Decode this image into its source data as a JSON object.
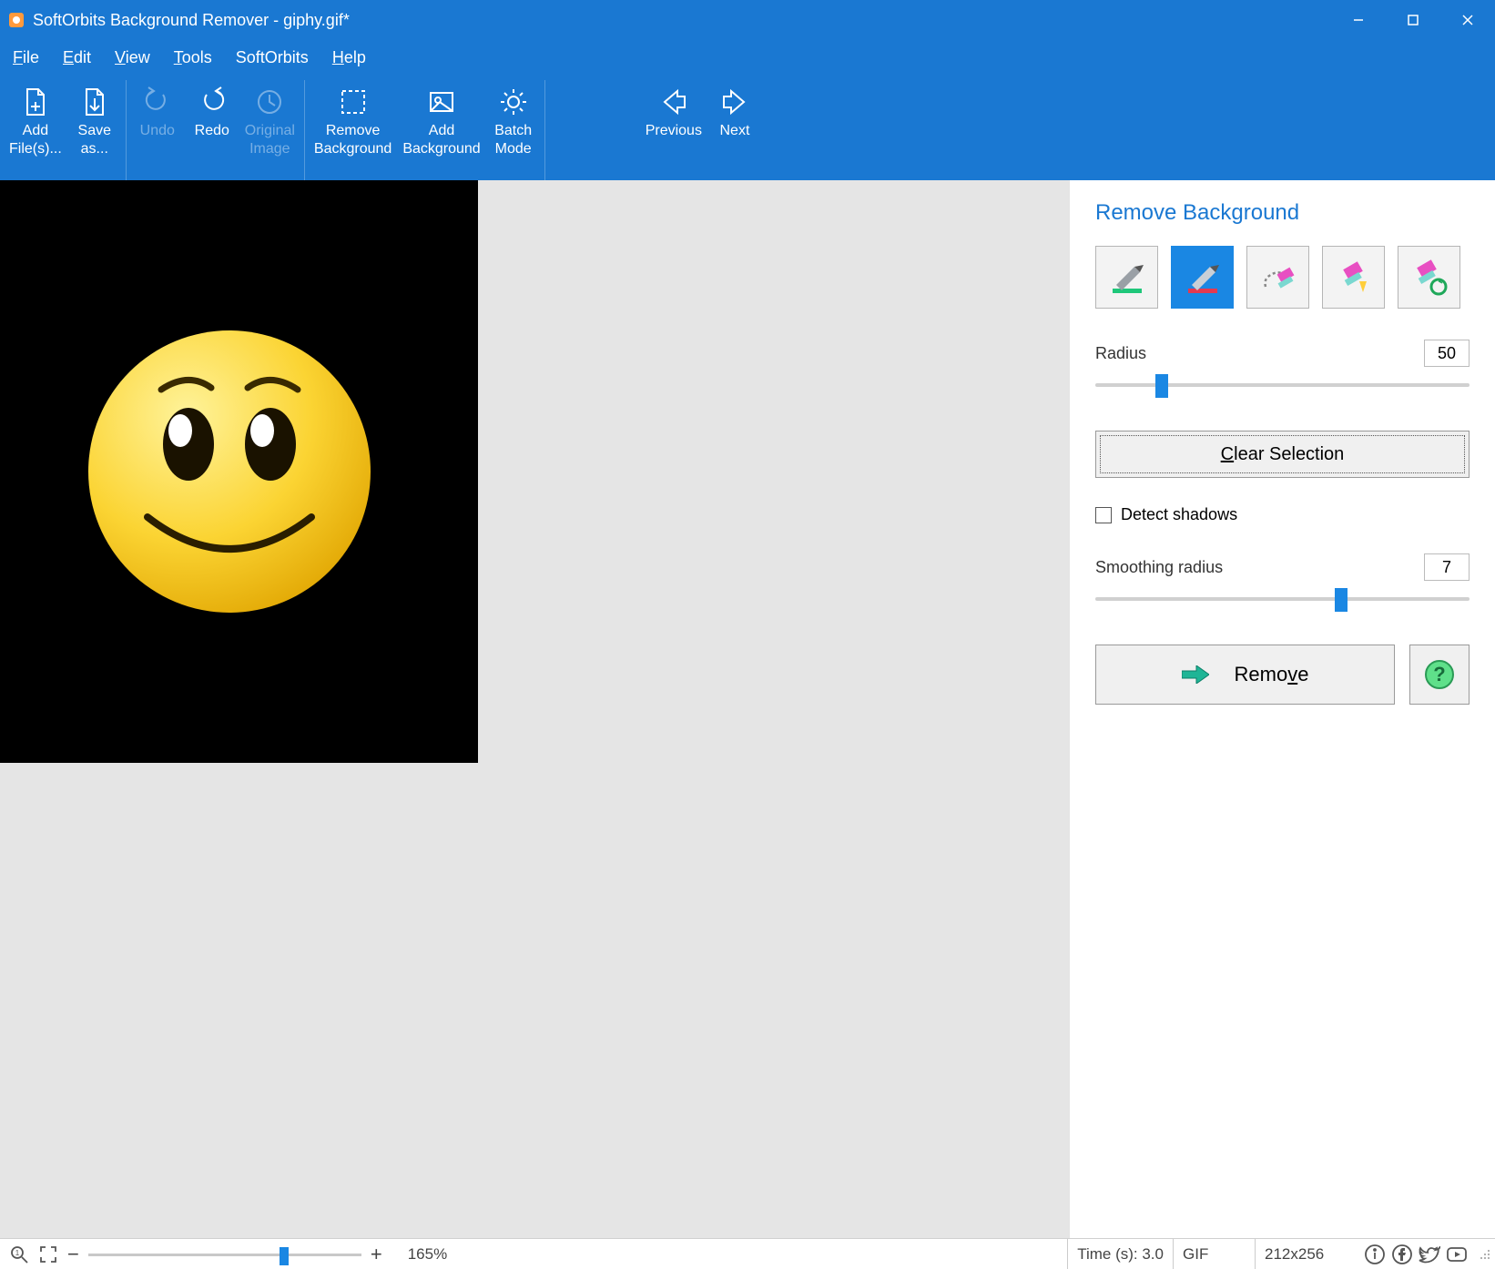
{
  "title": "SoftOrbits Background Remover - giphy.gif*",
  "menu": {
    "file": "File",
    "edit": "Edit",
    "view": "View",
    "tools": "Tools",
    "softorbits": "SoftOrbits",
    "help": "Help"
  },
  "toolbar": {
    "add_files": "Add\nFile(s)...",
    "save_as": "Save\nas...",
    "undo": "Undo",
    "redo": "Redo",
    "original": "Original\nImage",
    "remove_bg": "Remove\nBackground",
    "add_bg": "Add\nBackground",
    "batch": "Batch\nMode",
    "previous": "Previous",
    "next": "Next"
  },
  "panel": {
    "title": "Remove Background",
    "radius_label": "Radius",
    "radius_value": "50",
    "clear": "Clear Selection",
    "detect_shadows": "Detect shadows",
    "smoothing_label": "Smoothing radius",
    "smoothing_value": "7",
    "remove": "Remove"
  },
  "status": {
    "zoom_pct": "165%",
    "time": "Time (s): 3.0",
    "format": "GIF",
    "dims": "212x256"
  }
}
